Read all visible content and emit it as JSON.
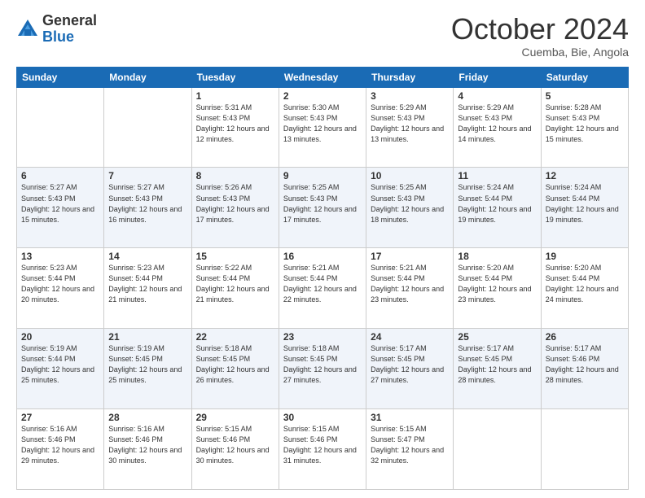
{
  "logo": {
    "general": "General",
    "blue": "Blue"
  },
  "header": {
    "month": "October 2024",
    "location": "Cuemba, Bie, Angola"
  },
  "days_of_week": [
    "Sunday",
    "Monday",
    "Tuesday",
    "Wednesday",
    "Thursday",
    "Friday",
    "Saturday"
  ],
  "weeks": [
    [
      {
        "day": "",
        "sunrise": "",
        "sunset": "",
        "daylight": ""
      },
      {
        "day": "",
        "sunrise": "",
        "sunset": "",
        "daylight": ""
      },
      {
        "day": "1",
        "sunrise": "Sunrise: 5:31 AM",
        "sunset": "Sunset: 5:43 PM",
        "daylight": "Daylight: 12 hours and 12 minutes."
      },
      {
        "day": "2",
        "sunrise": "Sunrise: 5:30 AM",
        "sunset": "Sunset: 5:43 PM",
        "daylight": "Daylight: 12 hours and 13 minutes."
      },
      {
        "day": "3",
        "sunrise": "Sunrise: 5:29 AM",
        "sunset": "Sunset: 5:43 PM",
        "daylight": "Daylight: 12 hours and 13 minutes."
      },
      {
        "day": "4",
        "sunrise": "Sunrise: 5:29 AM",
        "sunset": "Sunset: 5:43 PM",
        "daylight": "Daylight: 12 hours and 14 minutes."
      },
      {
        "day": "5",
        "sunrise": "Sunrise: 5:28 AM",
        "sunset": "Sunset: 5:43 PM",
        "daylight": "Daylight: 12 hours and 15 minutes."
      }
    ],
    [
      {
        "day": "6",
        "sunrise": "Sunrise: 5:27 AM",
        "sunset": "Sunset: 5:43 PM",
        "daylight": "Daylight: 12 hours and 15 minutes."
      },
      {
        "day": "7",
        "sunrise": "Sunrise: 5:27 AM",
        "sunset": "Sunset: 5:43 PM",
        "daylight": "Daylight: 12 hours and 16 minutes."
      },
      {
        "day": "8",
        "sunrise": "Sunrise: 5:26 AM",
        "sunset": "Sunset: 5:43 PM",
        "daylight": "Daylight: 12 hours and 17 minutes."
      },
      {
        "day": "9",
        "sunrise": "Sunrise: 5:25 AM",
        "sunset": "Sunset: 5:43 PM",
        "daylight": "Daylight: 12 hours and 17 minutes."
      },
      {
        "day": "10",
        "sunrise": "Sunrise: 5:25 AM",
        "sunset": "Sunset: 5:43 PM",
        "daylight": "Daylight: 12 hours and 18 minutes."
      },
      {
        "day": "11",
        "sunrise": "Sunrise: 5:24 AM",
        "sunset": "Sunset: 5:44 PM",
        "daylight": "Daylight: 12 hours and 19 minutes."
      },
      {
        "day": "12",
        "sunrise": "Sunrise: 5:24 AM",
        "sunset": "Sunset: 5:44 PM",
        "daylight": "Daylight: 12 hours and 19 minutes."
      }
    ],
    [
      {
        "day": "13",
        "sunrise": "Sunrise: 5:23 AM",
        "sunset": "Sunset: 5:44 PM",
        "daylight": "Daylight: 12 hours and 20 minutes."
      },
      {
        "day": "14",
        "sunrise": "Sunrise: 5:23 AM",
        "sunset": "Sunset: 5:44 PM",
        "daylight": "Daylight: 12 hours and 21 minutes."
      },
      {
        "day": "15",
        "sunrise": "Sunrise: 5:22 AM",
        "sunset": "Sunset: 5:44 PM",
        "daylight": "Daylight: 12 hours and 21 minutes."
      },
      {
        "day": "16",
        "sunrise": "Sunrise: 5:21 AM",
        "sunset": "Sunset: 5:44 PM",
        "daylight": "Daylight: 12 hours and 22 minutes."
      },
      {
        "day": "17",
        "sunrise": "Sunrise: 5:21 AM",
        "sunset": "Sunset: 5:44 PM",
        "daylight": "Daylight: 12 hours and 23 minutes."
      },
      {
        "day": "18",
        "sunrise": "Sunrise: 5:20 AM",
        "sunset": "Sunset: 5:44 PM",
        "daylight": "Daylight: 12 hours and 23 minutes."
      },
      {
        "day": "19",
        "sunrise": "Sunrise: 5:20 AM",
        "sunset": "Sunset: 5:44 PM",
        "daylight": "Daylight: 12 hours and 24 minutes."
      }
    ],
    [
      {
        "day": "20",
        "sunrise": "Sunrise: 5:19 AM",
        "sunset": "Sunset: 5:44 PM",
        "daylight": "Daylight: 12 hours and 25 minutes."
      },
      {
        "day": "21",
        "sunrise": "Sunrise: 5:19 AM",
        "sunset": "Sunset: 5:45 PM",
        "daylight": "Daylight: 12 hours and 25 minutes."
      },
      {
        "day": "22",
        "sunrise": "Sunrise: 5:18 AM",
        "sunset": "Sunset: 5:45 PM",
        "daylight": "Daylight: 12 hours and 26 minutes."
      },
      {
        "day": "23",
        "sunrise": "Sunrise: 5:18 AM",
        "sunset": "Sunset: 5:45 PM",
        "daylight": "Daylight: 12 hours and 27 minutes."
      },
      {
        "day": "24",
        "sunrise": "Sunrise: 5:17 AM",
        "sunset": "Sunset: 5:45 PM",
        "daylight": "Daylight: 12 hours and 27 minutes."
      },
      {
        "day": "25",
        "sunrise": "Sunrise: 5:17 AM",
        "sunset": "Sunset: 5:45 PM",
        "daylight": "Daylight: 12 hours and 28 minutes."
      },
      {
        "day": "26",
        "sunrise": "Sunrise: 5:17 AM",
        "sunset": "Sunset: 5:46 PM",
        "daylight": "Daylight: 12 hours and 28 minutes."
      }
    ],
    [
      {
        "day": "27",
        "sunrise": "Sunrise: 5:16 AM",
        "sunset": "Sunset: 5:46 PM",
        "daylight": "Daylight: 12 hours and 29 minutes."
      },
      {
        "day": "28",
        "sunrise": "Sunrise: 5:16 AM",
        "sunset": "Sunset: 5:46 PM",
        "daylight": "Daylight: 12 hours and 30 minutes."
      },
      {
        "day": "29",
        "sunrise": "Sunrise: 5:15 AM",
        "sunset": "Sunset: 5:46 PM",
        "daylight": "Daylight: 12 hours and 30 minutes."
      },
      {
        "day": "30",
        "sunrise": "Sunrise: 5:15 AM",
        "sunset": "Sunset: 5:46 PM",
        "daylight": "Daylight: 12 hours and 31 minutes."
      },
      {
        "day": "31",
        "sunrise": "Sunrise: 5:15 AM",
        "sunset": "Sunset: 5:47 PM",
        "daylight": "Daylight: 12 hours and 32 minutes."
      },
      {
        "day": "",
        "sunrise": "",
        "sunset": "",
        "daylight": ""
      },
      {
        "day": "",
        "sunrise": "",
        "sunset": "",
        "daylight": ""
      }
    ]
  ]
}
